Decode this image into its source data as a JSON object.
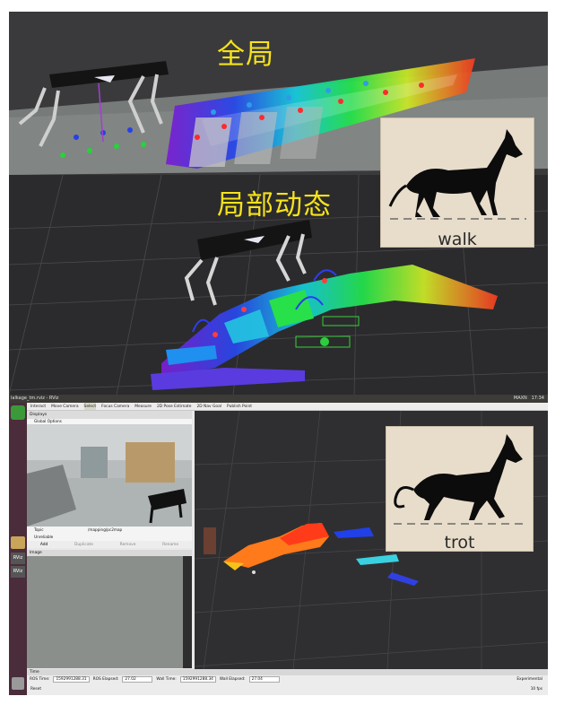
{
  "top_panel": {
    "caption": "全局"
  },
  "mid_panel": {
    "caption": "局部动态",
    "gait_card": {
      "label": "walk"
    }
  },
  "rviz": {
    "title": "lalkage_tm.rviz - RViz",
    "status_right": "17:34",
    "tray_text": "MAXN",
    "toolbar": [
      "Interact",
      "Move Camera",
      "Select",
      "Focus Camera",
      "Measure",
      "2D Pose Estimate",
      "2D Nav Goal",
      "Publish Point"
    ],
    "displays_title": "Displays",
    "global_options": "Global Options",
    "topic_label": "Topic",
    "topic_value": "/mapping/pc2map",
    "unreliable_label": "Unreliable",
    "buttons": [
      "Add",
      "Duplicate",
      "Remove",
      "Rename"
    ],
    "image_title": "Image",
    "time_title": "Time",
    "ros_time_label": "ROS Time:",
    "ros_time": "1592991288.31",
    "ros_elapsed_label": "ROS Elapsed:",
    "ros_elapsed": "27.02",
    "wall_time_label": "Wall Time:",
    "wall_time": "1592991288.34",
    "wall_elapsed_label": "Wall Elapsed:",
    "wall_elapsed": "27.04",
    "experimental": "Experimental",
    "reset": "Reset",
    "fps": "10 fps",
    "launcher_items": [
      "RViz",
      "RViz"
    ]
  },
  "bottom_card": {
    "label": "trot"
  },
  "colors": {
    "caption": "#f6e21a",
    "card_bg": "#e8ddcb",
    "launcher": "#4a2c3b"
  }
}
